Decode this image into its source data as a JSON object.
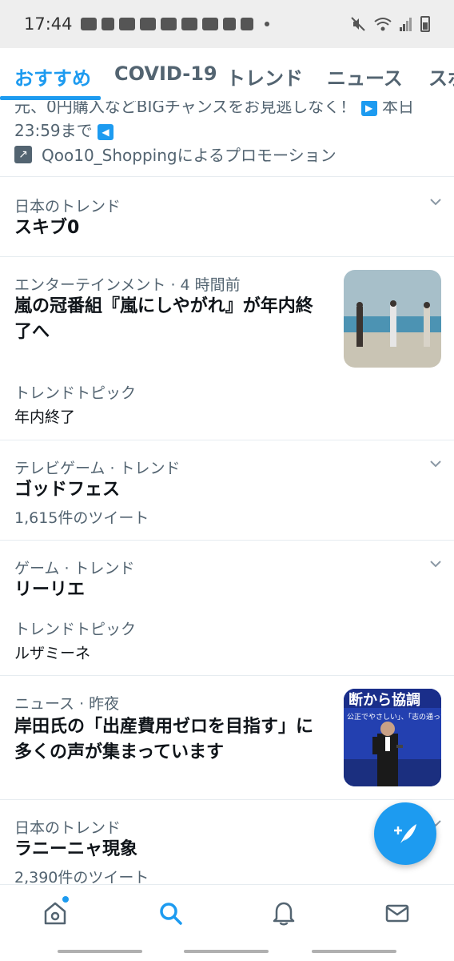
{
  "status_bar": {
    "time": "17:44"
  },
  "tabs": [
    {
      "label": "おすすめ",
      "active": true
    },
    {
      "label": "COVID-19"
    },
    {
      "label": "トレンド"
    },
    {
      "label": "ニュース"
    },
    {
      "label": "スポ"
    }
  ],
  "promo": {
    "text_line1": "元、0円購入などBIGチャンスをお見逃しなく！",
    "text_line1_tail": "本日",
    "text_line2": "23:59まで",
    "sponsor": "Qoo10_Shoppingによるプロモーション"
  },
  "feed": [
    {
      "meta": "日本のトレンド",
      "headline": "スキブ0"
    },
    {
      "meta": "エンターテインメント · 4 時間前",
      "headline_line1": "嵐の冠番組『嵐にしやがれ』が年内終",
      "headline_line2": "了へ",
      "sub_label": "トレンドトピック",
      "sub_value": "年内終了"
    },
    {
      "meta": "テレビゲーム · トレンド",
      "headline": "ゴッドフェス",
      "count": "1,615件のツイート"
    },
    {
      "meta": "ゲーム · トレンド",
      "headline": "リーリエ",
      "sub_label": "トレンドトピック",
      "sub_value": "ルザミーネ"
    },
    {
      "meta": "ニュース · 昨夜",
      "headline_line1": "岸田氏の「出産費用ゼロを目指す」に",
      "headline_line2": "多くの声が集まっています",
      "thumb_banner": "断から協調",
      "thumb_caption": "公正でやさしい」、「志の通った」"
    },
    {
      "meta": "日本のトレンド",
      "headline": "ラニーニャ現象",
      "count": "2,390件のツイート"
    }
  ],
  "colors": {
    "accent": "#1d9bf0",
    "secondary_text": "#536471",
    "divider": "#e6ecf0"
  },
  "icons": {
    "compose": "compose-tweet-icon",
    "home": "home-icon",
    "search": "search-icon",
    "notifications": "bell-icon",
    "messages": "mail-icon"
  }
}
